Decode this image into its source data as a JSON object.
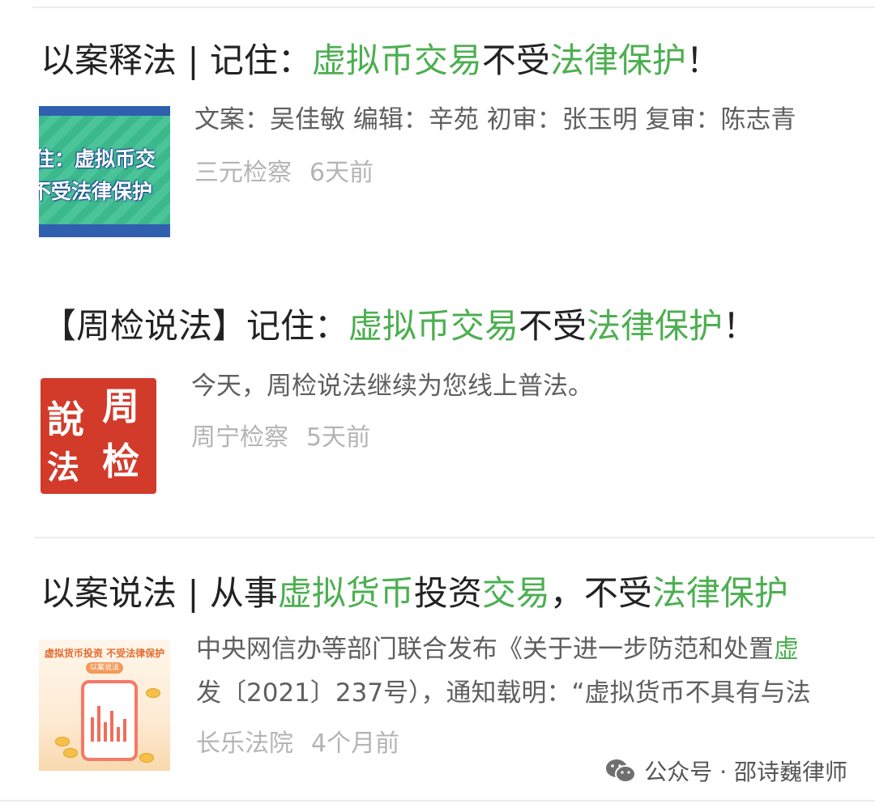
{
  "results": [
    {
      "title_parts": [
        {
          "text": "以案释法 | 记住：",
          "hl": false
        },
        {
          "text": "虚拟币交易",
          "hl": true
        },
        {
          "text": "不受",
          "hl": false
        },
        {
          "text": "法律保护",
          "hl": true
        },
        {
          "text": "！",
          "hl": false
        }
      ],
      "snippet_lines": [
        [
          {
            "text": "文案：吴佳敏 编辑：辛苑 初审：张玉明 复审：陈志青",
            "hl": false
          }
        ]
      ],
      "source": "三元检察",
      "date": "6天前",
      "thumb_text": [
        "住：虚拟币交",
        "不受法律保护"
      ]
    },
    {
      "title_parts": [
        {
          "text": "【周检说法】记住：",
          "hl": false
        },
        {
          "text": "虚拟币交易",
          "hl": true
        },
        {
          "text": "不受",
          "hl": false
        },
        {
          "text": "法律保护",
          "hl": true
        },
        {
          "text": "！",
          "hl": false
        }
      ],
      "snippet_lines": [
        [
          {
            "text": "今天，周检说法继续为您线上普法。",
            "hl": false
          }
        ]
      ],
      "source": "周宁检察",
      "date": "5天前",
      "thumb_text": [
        "周",
        "說",
        "检",
        "法"
      ]
    },
    {
      "title_parts": [
        {
          "text": "以案说法 | 从事",
          "hl": false
        },
        {
          "text": "虚拟货币",
          "hl": true
        },
        {
          "text": "投资",
          "hl": false
        },
        {
          "text": "交易",
          "hl": true
        },
        {
          "text": "，不受",
          "hl": false
        },
        {
          "text": "法律保护",
          "hl": true
        }
      ],
      "snippet_lines": [
        [
          {
            "text": "中央网信办等部门联合发布《关于进一步防范和处置",
            "hl": false
          },
          {
            "text": "虚",
            "hl": true
          }
        ],
        [
          {
            "text": "发〔2021〕237号），通知载明：“虚拟货币不具有与法",
            "hl": false
          }
        ]
      ],
      "source": "长乐法院",
      "date": "4个月前",
      "thumb_text": [
        "虚拟货币投资 不受法律保护",
        "以案说法"
      ]
    }
  ],
  "watermark": {
    "icon": "wechat-icon",
    "text": "公众号 · 邵诗巍律师"
  },
  "colors": {
    "highlight": "#4caf50",
    "title": "#222222",
    "snippet": "#5f5f5f",
    "meta": "#b4b4b4"
  }
}
